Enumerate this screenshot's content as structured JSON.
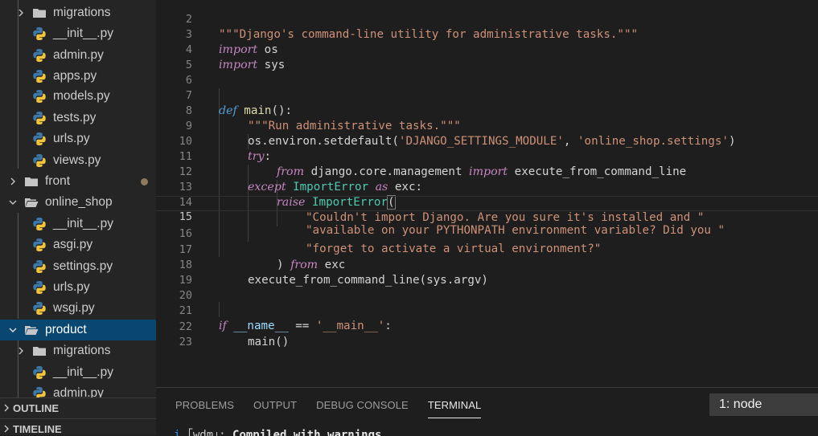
{
  "explorer": {
    "items": [
      {
        "label": "migrations",
        "kind": "folder",
        "expanded": false
      },
      {
        "label": "__init__.py",
        "kind": "py"
      },
      {
        "label": "admin.py",
        "kind": "py"
      },
      {
        "label": "apps.py",
        "kind": "py"
      },
      {
        "label": "models.py",
        "kind": "py"
      },
      {
        "label": "tests.py",
        "kind": "py"
      },
      {
        "label": "urls.py",
        "kind": "py"
      },
      {
        "label": "views.py",
        "kind": "py"
      },
      {
        "label": "front",
        "kind": "folder",
        "expanded": false
      },
      {
        "label": "online_shop",
        "kind": "folder",
        "expanded": true
      },
      {
        "label": "__init__.py",
        "kind": "py"
      },
      {
        "label": "asgi.py",
        "kind": "py"
      },
      {
        "label": "settings.py",
        "kind": "py"
      },
      {
        "label": "urls.py",
        "kind": "py"
      },
      {
        "label": "wsgi.py",
        "kind": "py"
      },
      {
        "label": "product",
        "kind": "folder",
        "expanded": true
      },
      {
        "label": "migrations",
        "kind": "folder",
        "expanded": false
      },
      {
        "label": "__init__.py",
        "kind": "py"
      },
      {
        "label": "admin.py",
        "kind": "py"
      }
    ],
    "outline_label": "OUTLINE",
    "timeline_label": "TIMELINE"
  },
  "editor": {
    "line_numbers": [
      "2",
      "3",
      "4",
      "5",
      "6",
      "7",
      "8",
      "9",
      "10",
      "11",
      "12",
      "13",
      "14",
      "15",
      "16",
      "17",
      "18",
      "19",
      "20",
      "21",
      "22",
      "23"
    ],
    "lines": {
      "l2": {
        "s1": "\"\"\"Django's command-line utility for administrative tasks.\"\"\""
      },
      "l3": {
        "k1": "import",
        "t1": " os"
      },
      "l4": {
        "k1": "import",
        "t1": " sys"
      },
      "l7": {
        "k1": "def",
        "f1": "main",
        "t1": "():"
      },
      "l8": {
        "s1": "\"\"\"Run administrative tasks.\"\"\""
      },
      "l9": {
        "t1": "os.environ.setdefault(",
        "s1": "'DJANGO_SETTINGS_MODULE'",
        "t2": ", ",
        "s2": "'online_shop.settings'",
        "t3": ")"
      },
      "l10": {
        "k1": "try",
        "t1": ":"
      },
      "l11": {
        "k1": "from",
        "t1": " django.core.management ",
        "k2": "import",
        "t2": " execute_from_command_line"
      },
      "l12": {
        "k1": "except",
        "c1": "ImportError",
        "k2": "as",
        "t1": " exc:"
      },
      "l13": {
        "k1": "raise",
        "c1": "ImportError",
        "t1": "("
      },
      "l14": {
        "s1": "\"Couldn't import Django. Are you sure it's installed and \""
      },
      "l15": {
        "s1": "\"available on your PYTHONPATH environment variable? Did you \""
      },
      "l16": {
        "s1": "\"forget to activate a virtual environment?\""
      },
      "l17": {
        "t1": ") ",
        "k1": "from",
        "t2": " exc"
      },
      "l18": {
        "t1": "execute_from_command_line(sys.argv)"
      },
      "l21": {
        "k1": "if",
        "v1": "__name__",
        "t1": " == ",
        "s1": "'__main__'",
        "t2": ":"
      },
      "l22": {
        "t1": "main()"
      }
    }
  },
  "panel": {
    "tabs": [
      "PROBLEMS",
      "OUTPUT",
      "DEBUG CONSOLE",
      "TERMINAL"
    ],
    "active_tab": "TERMINAL",
    "terminal_select": "1: node",
    "terminal_text": {
      "info": "i",
      "bracket": " ｢wdm｣: ",
      "msg": "Compiled with warnings."
    }
  }
}
